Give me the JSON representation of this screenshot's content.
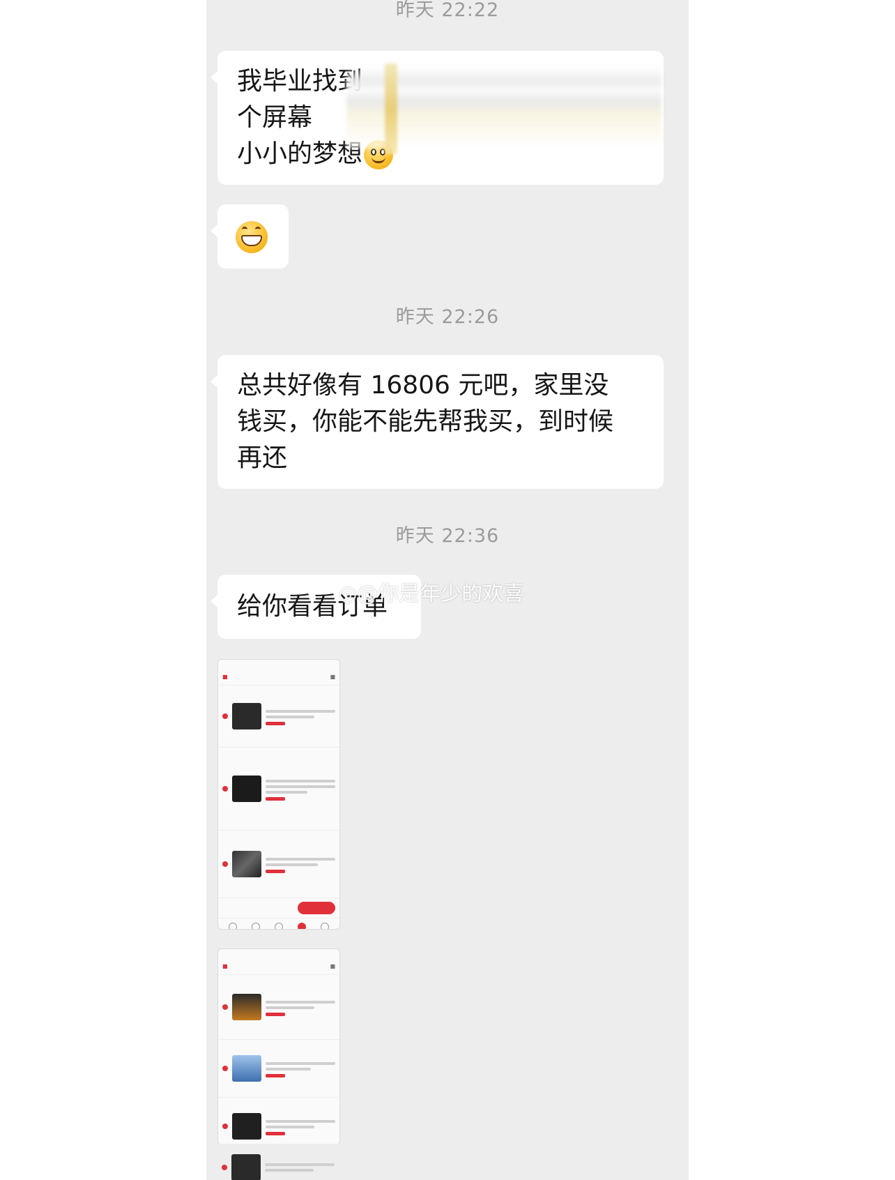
{
  "chat": {
    "timestamps": [
      "昨天 22:22",
      "昨天 22:26",
      "昨天 22:36"
    ],
    "messages": {
      "m1": {
        "lines": [
          "我毕业找到",
          "个屏幕",
          "小小的梦想"
        ]
      },
      "m3": {
        "lines": [
          "总共好像有 16806 元吧，家里没",
          "钱买，你能不能先帮我买，到时候",
          "再还"
        ]
      },
      "m4": {
        "text": "给你看看订单"
      }
    },
    "watermark": "@你是年少的欢喜"
  },
  "colors": {
    "bubble": "#ffffff",
    "background": "#ededed",
    "accent": "#e0303a"
  },
  "icons": [
    "smiley-emoji-icon",
    "grinning-emoji-icon",
    "weibo-icon"
  ]
}
